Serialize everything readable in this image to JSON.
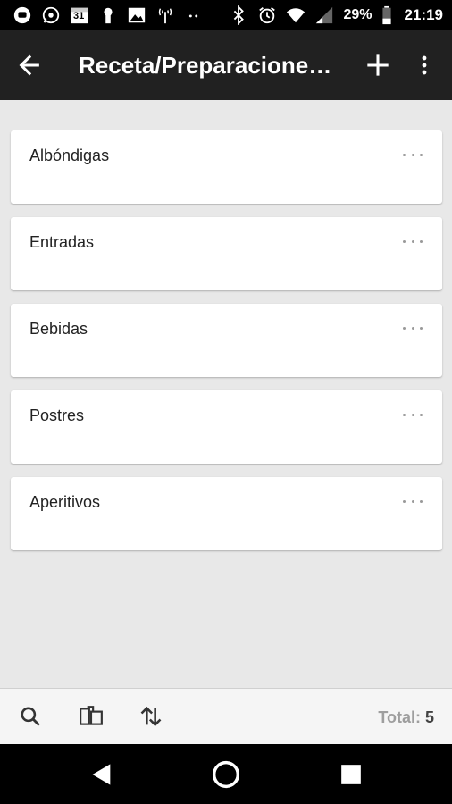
{
  "status_bar": {
    "battery": "29%",
    "time": "21:19",
    "calendar_day": "31"
  },
  "app_bar": {
    "title": "Receta/Preparacione…"
  },
  "list": {
    "items": [
      {
        "label": "Albóndigas"
      },
      {
        "label": "Entradas"
      },
      {
        "label": "Bebidas"
      },
      {
        "label": "Postres"
      },
      {
        "label": "Aperitivos"
      }
    ]
  },
  "bottom_bar": {
    "total_label": "Total:",
    "total_value": "5"
  },
  "colors": {
    "status_bar_bg": "#000000",
    "app_bar_bg": "#212121",
    "page_bg": "#e8e8e8",
    "card_bg": "#ffffff"
  }
}
